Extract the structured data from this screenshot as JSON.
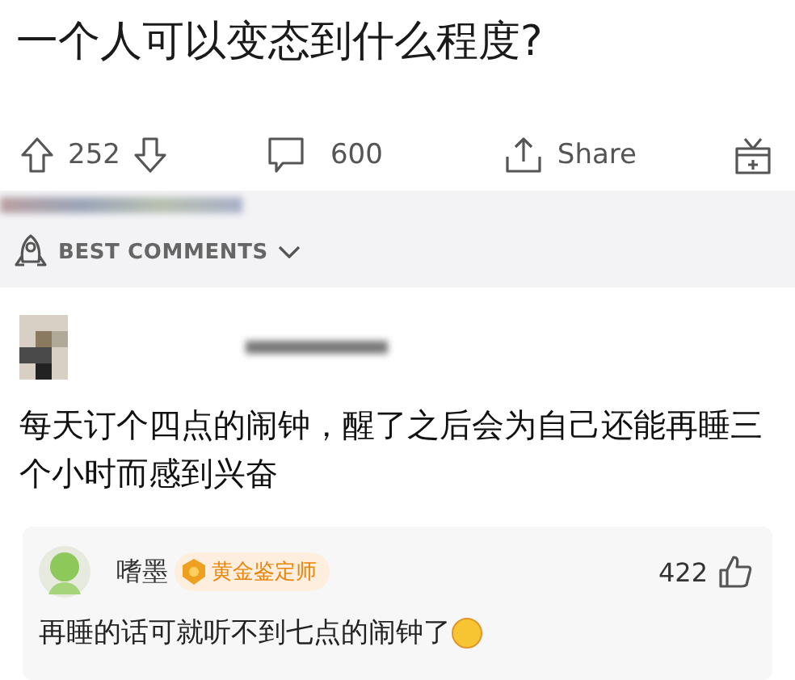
{
  "post": {
    "title": "一个人可以变态到什么程度?"
  },
  "actions": {
    "upvotes": "252",
    "comments": "600",
    "share": "Share"
  },
  "sort": {
    "label": "BEST COMMENTS"
  },
  "comment": {
    "text": "每天订个四点的闹钟，醒了之后会为自己还能再睡三个小时而感到兴奋"
  },
  "reply": {
    "author": "嗜墨",
    "badge": "黄金鉴定师",
    "likes": "422",
    "text": "再睡的话可就听不到七点的闹钟了"
  }
}
